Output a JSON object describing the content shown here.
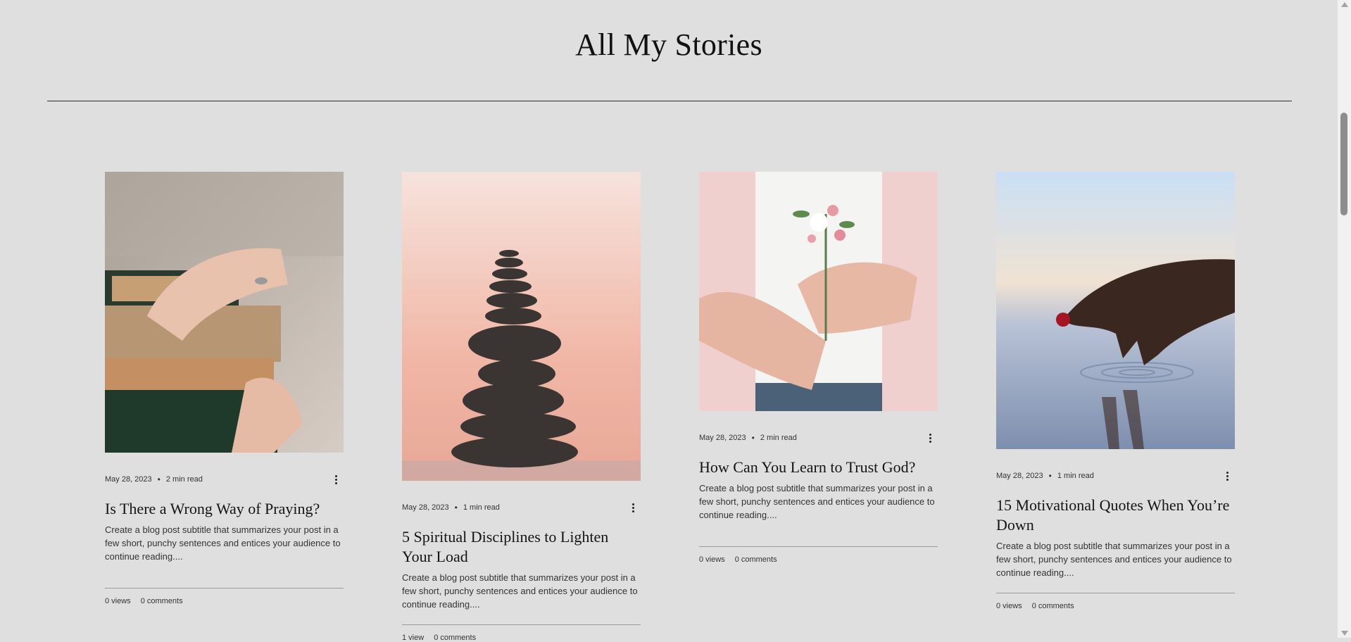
{
  "page": {
    "title": "All My Stories"
  },
  "posts": [
    {
      "date": "May 28, 2023",
      "read_time": "2 min read",
      "title": "Is There a Wrong Way of Praying?",
      "excerpt": "Create a blog post subtitle that summarizes your post in a few short, punchy sentences and entices your audience to continue reading....",
      "views": "0 views",
      "comments": "0 comments",
      "image": "hands-holding-old-books-photo"
    },
    {
      "date": "May 28, 2023",
      "read_time": "1 min read",
      "title": "5 Spiritual Disciplines to Lighten Your Load",
      "excerpt": "Create a blog post subtitle that summarizes your post in a few short, punchy sentences and entices your audience to continue reading....",
      "views": "1 view",
      "comments": "0 comments",
      "image": "stacked-stones-pink-sky-photo"
    },
    {
      "date": "May 28, 2023",
      "read_time": "2 min read",
      "title": "How Can You Learn to Trust God?",
      "excerpt": "Create a blog post subtitle that summarizes your post in a few short, punchy sentences and entices your audience to continue reading....",
      "views": "0 views",
      "comments": "0 comments",
      "image": "hands-holding-flower-sprig-photo"
    },
    {
      "date": "May 28, 2023",
      "read_time": "1 min read",
      "title": "15 Motivational Quotes When You’re Down",
      "excerpt": "Create a blog post subtitle that summarizes your post in a few short, punchy sentences and entices your audience to continue reading....",
      "views": "0 views",
      "comments": "0 comments",
      "image": "hand-touching-water-photo"
    }
  ],
  "icons": {
    "more_actions": "more-vertical-icon"
  },
  "colors": {
    "background": "#dfdfdf",
    "divider": "#2a2a2a",
    "text": "#222222"
  }
}
